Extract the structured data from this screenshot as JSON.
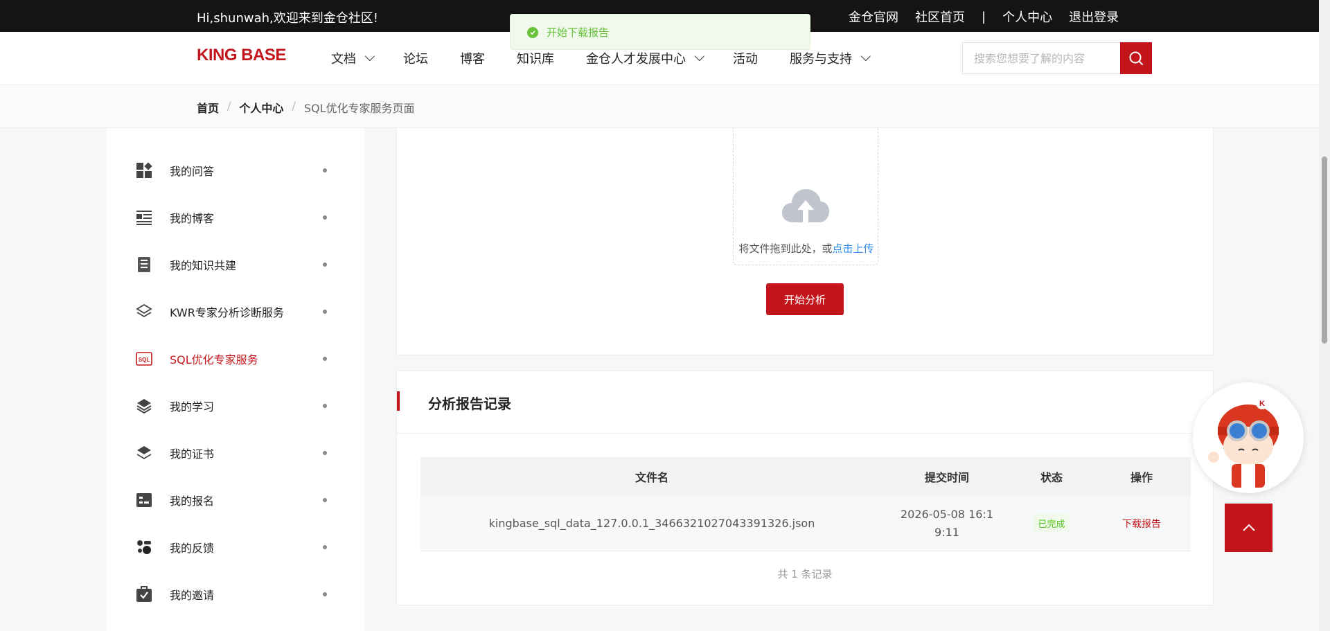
{
  "topbar": {
    "greeting": "Hi,shunwah,欢迎来到金仓社区!",
    "links": [
      "金仓官网",
      "社区首页",
      "|",
      "个人中心",
      "退出登录"
    ]
  },
  "nav": {
    "logo": "KING BASE",
    "menu": [
      "文档",
      "论坛",
      "博客",
      "知识库",
      "金仓人才发展中心",
      "活动",
      "服务与支持"
    ],
    "search_placeholder": "搜索您想要了解的内容",
    "search_icon": "search-icon"
  },
  "breadcrumb": [
    "首页",
    "个人中心",
    "SQL优化专家服务页面"
  ],
  "sidebar": {
    "items": [
      {
        "label": "我的问答",
        "icon": "qa-grid-icon"
      },
      {
        "label": "我的博客",
        "icon": "blog-list-icon"
      },
      {
        "label": "我的知识共建",
        "icon": "knowledge-book-icon"
      },
      {
        "label": "KWR专家分析诊断服务",
        "icon": "layers-outline-icon"
      },
      {
        "label": "SQL优化专家服务",
        "icon": "sql-icon",
        "active": true
      },
      {
        "label": "我的学习",
        "icon": "layers-stack-icon"
      },
      {
        "label": "我的证书",
        "icon": "layers-solid-icon"
      },
      {
        "label": "我的报名",
        "icon": "form-card-icon"
      },
      {
        "label": "我的反馈",
        "icon": "feedback-icon"
      },
      {
        "label": "我的邀请",
        "icon": "briefcase-check-icon"
      }
    ]
  },
  "upload": {
    "drop_text": "将文件拖到此处，或",
    "click_upload": "点击上传",
    "analyze_button": "开始分析"
  },
  "records": {
    "title": "分析报告记录",
    "columns": [
      "文件名",
      "提交时间",
      "状态",
      "操作"
    ],
    "rows": [
      {
        "filename": "kingbase_sql_data_127.0.0.1_3466321027043391326.json",
        "time": "2026-05-08 16:19:11",
        "status": "已完成",
        "action": "下载报告"
      }
    ],
    "total": "共 1 条记录"
  },
  "toast": {
    "message": "开始下载报告"
  },
  "colors": {
    "brand": "#c3161c",
    "success": "#67c23a",
    "link": "#2d8cf0"
  }
}
